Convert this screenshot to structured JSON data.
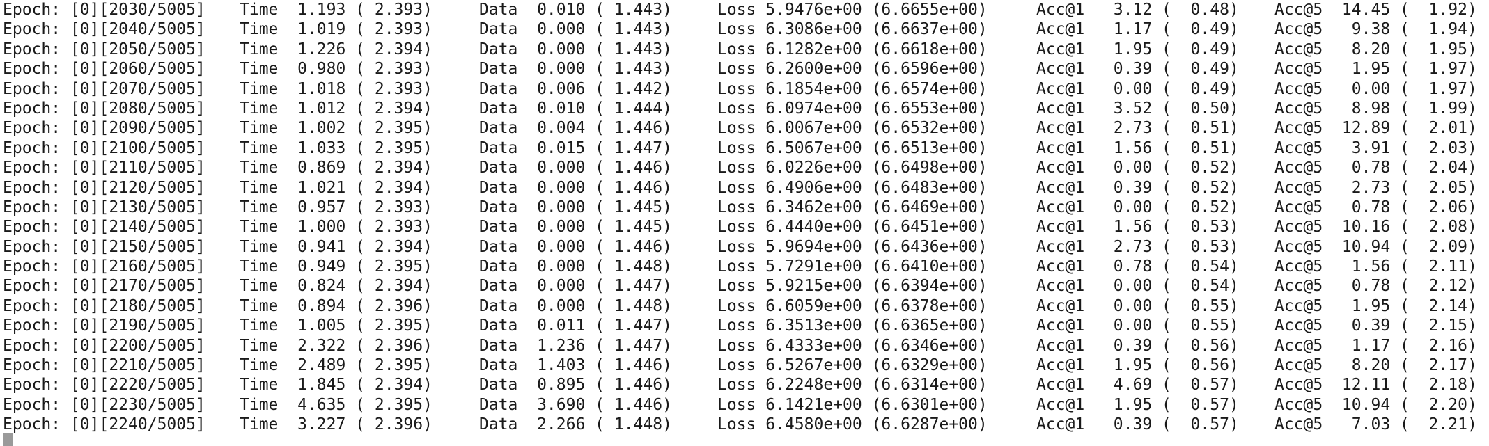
{
  "window": {
    "type": "terminal",
    "content": "training-log"
  },
  "log_lines": [
    {
      "epoch": "Epoch: [0][2030/5005]",
      "time": "Time  1.193 ( 2.393)",
      "data": "Data  0.010 ( 1.443)",
      "loss": "Loss 5.9476e+00 (6.6655e+00)",
      "acc1": "Acc@1   3.12 (  0.48)",
      "acc5": "Acc@5  14.45 (  1.92)"
    },
    {
      "epoch": "Epoch: [0][2040/5005]",
      "time": "Time  1.019 ( 2.393)",
      "data": "Data  0.000 ( 1.443)",
      "loss": "Loss 6.3086e+00 (6.6637e+00)",
      "acc1": "Acc@1   1.17 (  0.49)",
      "acc5": "Acc@5   9.38 (  1.94)"
    },
    {
      "epoch": "Epoch: [0][2050/5005]",
      "time": "Time  1.226 ( 2.394)",
      "data": "Data  0.000 ( 1.443)",
      "loss": "Loss 6.1282e+00 (6.6618e+00)",
      "acc1": "Acc@1   1.95 (  0.49)",
      "acc5": "Acc@5   8.20 (  1.95)"
    },
    {
      "epoch": "Epoch: [0][2060/5005]",
      "time": "Time  0.980 ( 2.393)",
      "data": "Data  0.000 ( 1.443)",
      "loss": "Loss 6.2600e+00 (6.6596e+00)",
      "acc1": "Acc@1   0.39 (  0.49)",
      "acc5": "Acc@5   1.95 (  1.97)"
    },
    {
      "epoch": "Epoch: [0][2070/5005]",
      "time": "Time  1.018 ( 2.393)",
      "data": "Data  0.006 ( 1.442)",
      "loss": "Loss 6.1854e+00 (6.6574e+00)",
      "acc1": "Acc@1   0.00 (  0.49)",
      "acc5": "Acc@5   0.00 (  1.97)"
    },
    {
      "epoch": "Epoch: [0][2080/5005]",
      "time": "Time  1.012 ( 2.394)",
      "data": "Data  0.010 ( 1.444)",
      "loss": "Loss 6.0974e+00 (6.6553e+00)",
      "acc1": "Acc@1   3.52 (  0.50)",
      "acc5": "Acc@5   8.98 (  1.99)"
    },
    {
      "epoch": "Epoch: [0][2090/5005]",
      "time": "Time  1.002 ( 2.395)",
      "data": "Data  0.004 ( 1.446)",
      "loss": "Loss 6.0067e+00 (6.6532e+00)",
      "acc1": "Acc@1   2.73 (  0.51)",
      "acc5": "Acc@5  12.89 (  2.01)"
    },
    {
      "epoch": "Epoch: [0][2100/5005]",
      "time": "Time  1.033 ( 2.395)",
      "data": "Data  0.015 ( 1.447)",
      "loss": "Loss 6.5067e+00 (6.6513e+00)",
      "acc1": "Acc@1   1.56 (  0.51)",
      "acc5": "Acc@5   3.91 (  2.03)"
    },
    {
      "epoch": "Epoch: [0][2110/5005]",
      "time": "Time  0.869 ( 2.394)",
      "data": "Data  0.000 ( 1.446)",
      "loss": "Loss 6.0226e+00 (6.6498e+00)",
      "acc1": "Acc@1   0.00 (  0.52)",
      "acc5": "Acc@5   0.78 (  2.04)"
    },
    {
      "epoch": "Epoch: [0][2120/5005]",
      "time": "Time  1.021 ( 2.394)",
      "data": "Data  0.000 ( 1.446)",
      "loss": "Loss 6.4906e+00 (6.6483e+00)",
      "acc1": "Acc@1   0.39 (  0.52)",
      "acc5": "Acc@5   2.73 (  2.05)"
    },
    {
      "epoch": "Epoch: [0][2130/5005]",
      "time": "Time  0.957 ( 2.393)",
      "data": "Data  0.000 ( 1.445)",
      "loss": "Loss 6.3462e+00 (6.6469e+00)",
      "acc1": "Acc@1   0.00 (  0.52)",
      "acc5": "Acc@5   0.78 (  2.06)"
    },
    {
      "epoch": "Epoch: [0][2140/5005]",
      "time": "Time  1.000 ( 2.393)",
      "data": "Data  0.000 ( 1.445)",
      "loss": "Loss 6.4440e+00 (6.6451e+00)",
      "acc1": "Acc@1   1.56 (  0.53)",
      "acc5": "Acc@5  10.16 (  2.08)"
    },
    {
      "epoch": "Epoch: [0][2150/5005]",
      "time": "Time  0.941 ( 2.394)",
      "data": "Data  0.000 ( 1.446)",
      "loss": "Loss 5.9694e+00 (6.6436e+00)",
      "acc1": "Acc@1   2.73 (  0.53)",
      "acc5": "Acc@5  10.94 (  2.09)"
    },
    {
      "epoch": "Epoch: [0][2160/5005]",
      "time": "Time  0.949 ( 2.395)",
      "data": "Data  0.000 ( 1.448)",
      "loss": "Loss 5.7291e+00 (6.6410e+00)",
      "acc1": "Acc@1   0.78 (  0.54)",
      "acc5": "Acc@5   1.56 (  2.11)"
    },
    {
      "epoch": "Epoch: [0][2170/5005]",
      "time": "Time  0.824 ( 2.394)",
      "data": "Data  0.000 ( 1.447)",
      "loss": "Loss 5.9215e+00 (6.6394e+00)",
      "acc1": "Acc@1   0.00 (  0.54)",
      "acc5": "Acc@5   0.78 (  2.12)"
    },
    {
      "epoch": "Epoch: [0][2180/5005]",
      "time": "Time  0.894 ( 2.396)",
      "data": "Data  0.000 ( 1.448)",
      "loss": "Loss 6.6059e+00 (6.6378e+00)",
      "acc1": "Acc@1   0.00 (  0.55)",
      "acc5": "Acc@5   1.95 (  2.14)"
    },
    {
      "epoch": "Epoch: [0][2190/5005]",
      "time": "Time  1.005 ( 2.395)",
      "data": "Data  0.011 ( 1.447)",
      "loss": "Loss 6.3513e+00 (6.6365e+00)",
      "acc1": "Acc@1   0.00 (  0.55)",
      "acc5": "Acc@5   0.39 (  2.15)"
    },
    {
      "epoch": "Epoch: [0][2200/5005]",
      "time": "Time  2.322 ( 2.396)",
      "data": "Data  1.236 ( 1.447)",
      "loss": "Loss 6.4333e+00 (6.6346e+00)",
      "acc1": "Acc@1   0.39 (  0.56)",
      "acc5": "Acc@5   1.17 (  2.16)"
    },
    {
      "epoch": "Epoch: [0][2210/5005]",
      "time": "Time  2.489 ( 2.395)",
      "data": "Data  1.403 ( 1.446)",
      "loss": "Loss 6.5267e+00 (6.6329e+00)",
      "acc1": "Acc@1   1.95 (  0.56)",
      "acc5": "Acc@5   8.20 (  2.17)"
    },
    {
      "epoch": "Epoch: [0][2220/5005]",
      "time": "Time  1.845 ( 2.394)",
      "data": "Data  0.895 ( 1.446)",
      "loss": "Loss 6.2248e+00 (6.6314e+00)",
      "acc1": "Acc@1   4.69 (  0.57)",
      "acc5": "Acc@5  12.11 (  2.18)"
    },
    {
      "epoch": "Epoch: [0][2230/5005]",
      "time": "Time  4.635 ( 2.395)",
      "data": "Data  3.690 ( 1.446)",
      "loss": "Loss 6.1421e+00 (6.6301e+00)",
      "acc1": "Acc@1   1.95 (  0.57)",
      "acc5": "Acc@5  10.94 (  2.20)"
    },
    {
      "epoch": "Epoch: [0][2240/5005]",
      "time": "Time  3.227 ( 2.396)",
      "data": "Data  2.266 ( 1.448)",
      "loss": "Loss 6.4580e+00 (6.6287e+00)",
      "acc1": "Acc@1   0.39 (  0.57)",
      "acc5": "Acc@5   7.03 (  2.21)"
    }
  ],
  "cursor": {
    "icon": "block-cursor-icon",
    "color": "#9a9a9a"
  },
  "colors": {
    "background": "#ffffff",
    "text": "#1a1a1a"
  }
}
